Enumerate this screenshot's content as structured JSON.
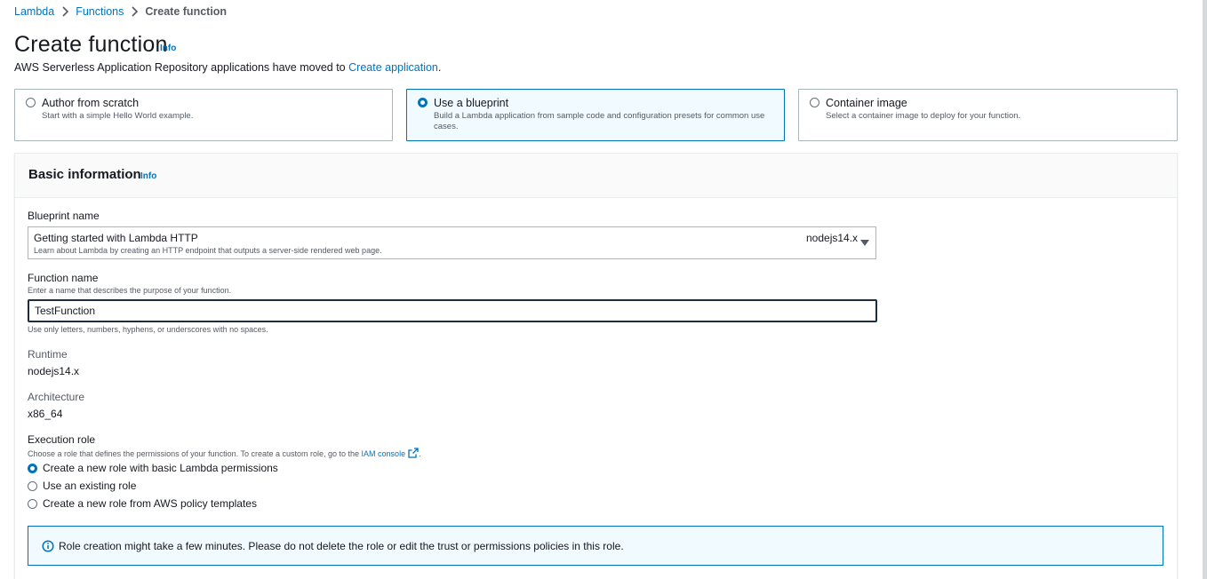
{
  "breadcrumb": {
    "items": [
      "Lambda",
      "Functions"
    ],
    "current": "Create function"
  },
  "header": {
    "title": "Create function",
    "info": "Info",
    "moved_text": "AWS Serverless Application Repository applications have moved to ",
    "moved_link": "Create application",
    "moved_suffix": "."
  },
  "options": [
    {
      "title": "Author from scratch",
      "description": "Start with a simple Hello World example.",
      "selected": false
    },
    {
      "title": "Use a blueprint",
      "description": "Build a Lambda application from sample code and configuration presets for common use cases.",
      "selected": true
    },
    {
      "title": "Container image",
      "description": "Select a container image to deploy for your function.",
      "selected": false
    }
  ],
  "basic_info": {
    "title": "Basic information",
    "info": "Info",
    "blueprint": {
      "label": "Blueprint name",
      "selected_title": "Getting started with Lambda HTTP",
      "selected_description": "Learn about Lambda by creating an HTTP endpoint that outputs a server-side rendered web page.",
      "selected_tag": "nodejs14.x"
    },
    "function_name": {
      "label": "Function name",
      "description": "Enter a name that describes the purpose of your function.",
      "value": "TestFunction",
      "constraint": "Use only letters, numbers, hyphens, or underscores with no spaces."
    },
    "runtime": {
      "label": "Runtime",
      "value": "nodejs14.x"
    },
    "architecture": {
      "label": "Architecture",
      "value": "x86_64"
    },
    "execution_role": {
      "label": "Execution role",
      "description": "Choose a role that defines the permissions of your function. To create a custom role, go to the ",
      "link": "IAM console",
      "suffix": ".",
      "options": [
        {
          "label": "Create a new role with basic Lambda permissions",
          "selected": true
        },
        {
          "label": "Use an existing role",
          "selected": false
        },
        {
          "label": "Create a new role from AWS policy templates",
          "selected": false
        }
      ]
    },
    "alert": "Role creation might take a few minutes. Please do not delete the role or edit the trust or permissions policies in this role."
  },
  "colors": {
    "link": "#0073bb",
    "text": "#16191f",
    "muted": "#545b64",
    "selected_bg": "#f1faff",
    "border": "#aab7b8"
  }
}
